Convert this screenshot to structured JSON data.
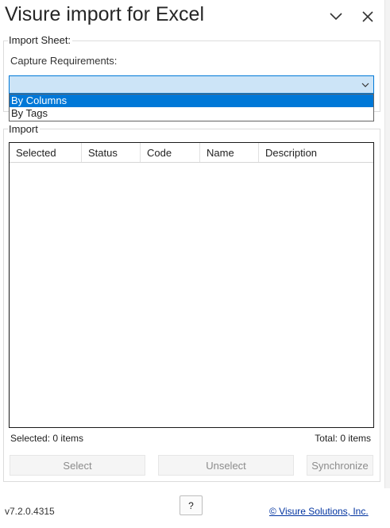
{
  "window": {
    "title": "Visure import for Excel",
    "collapse_icon": "chevron-down-icon",
    "close_icon": "close-icon"
  },
  "import_sheet": {
    "legend": "Import Sheet:",
    "capture_label": "Capture Requirements:",
    "combo_value": "",
    "options": [
      "By Columns",
      "By Tags"
    ],
    "selected_option": "By Columns"
  },
  "import": {
    "legend": "Import",
    "columns": [
      "Selected",
      "Status",
      "Code",
      "Name",
      "Description"
    ],
    "rows": [],
    "selected_count_text": "Selected: 0 items",
    "total_count_text": "Total: 0 items"
  },
  "buttons": {
    "select": "Select",
    "unselect": "Unselect",
    "synchronize": "Synchronize"
  },
  "footer": {
    "version": "v7.2.0.4315",
    "help": "?",
    "copyright": "© Visure Solutions, Inc."
  },
  "colors": {
    "combo_bg": "#cce4f7",
    "combo_border": "#0078d7",
    "selection": "#0078d7",
    "link": "#0033a0",
    "disabled_text": "#8c8c8c"
  }
}
